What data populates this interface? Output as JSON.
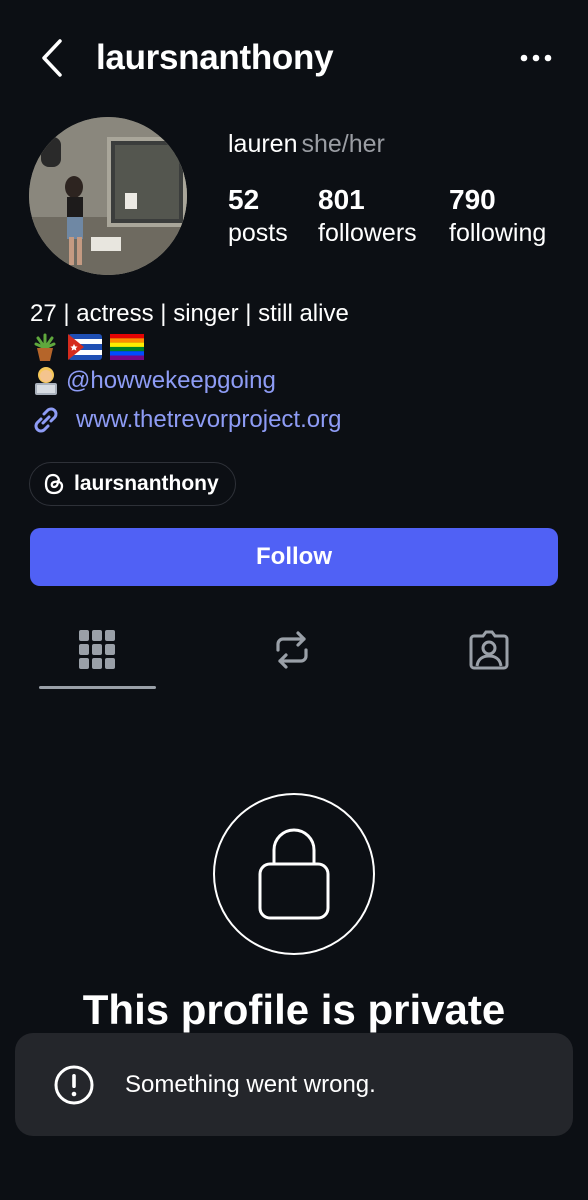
{
  "header": {
    "title": "laursnanthony",
    "back_icon": "chevron-left-icon",
    "more_icon": "ellipsis-icon"
  },
  "profile": {
    "display_name": "lauren",
    "pronouns": "she/her",
    "stats": [
      {
        "value": "52",
        "label": "posts"
      },
      {
        "value": "801",
        "label": "followers"
      },
      {
        "value": "790",
        "label": "following"
      }
    ]
  },
  "bio": {
    "line1": "27 | actress | singer | still alive",
    "emojis": [
      "potted-plant",
      "cuba-flag",
      "rainbow-flag"
    ],
    "mention": "@howwekeepgoing",
    "link": "www.thetrevorproject.org"
  },
  "threads": {
    "label": "laursnanthony",
    "icon": "threads-icon"
  },
  "actions": {
    "follow_label": "Follow"
  },
  "tabs": [
    {
      "name": "posts",
      "icon": "grid-icon",
      "active": true
    },
    {
      "name": "reposts",
      "icon": "repost-icon",
      "active": false
    },
    {
      "name": "tagged",
      "icon": "tagged-icon",
      "active": false
    }
  ],
  "private_notice": {
    "title": "This profile is private",
    "icon": "lock-icon"
  },
  "toast": {
    "message": "Something went wrong.",
    "icon": "alert-icon"
  },
  "colors": {
    "background": "#0c0f14",
    "accent": "#5061f5",
    "link": "#8e9cf5",
    "toast_bg": "#24262b"
  }
}
